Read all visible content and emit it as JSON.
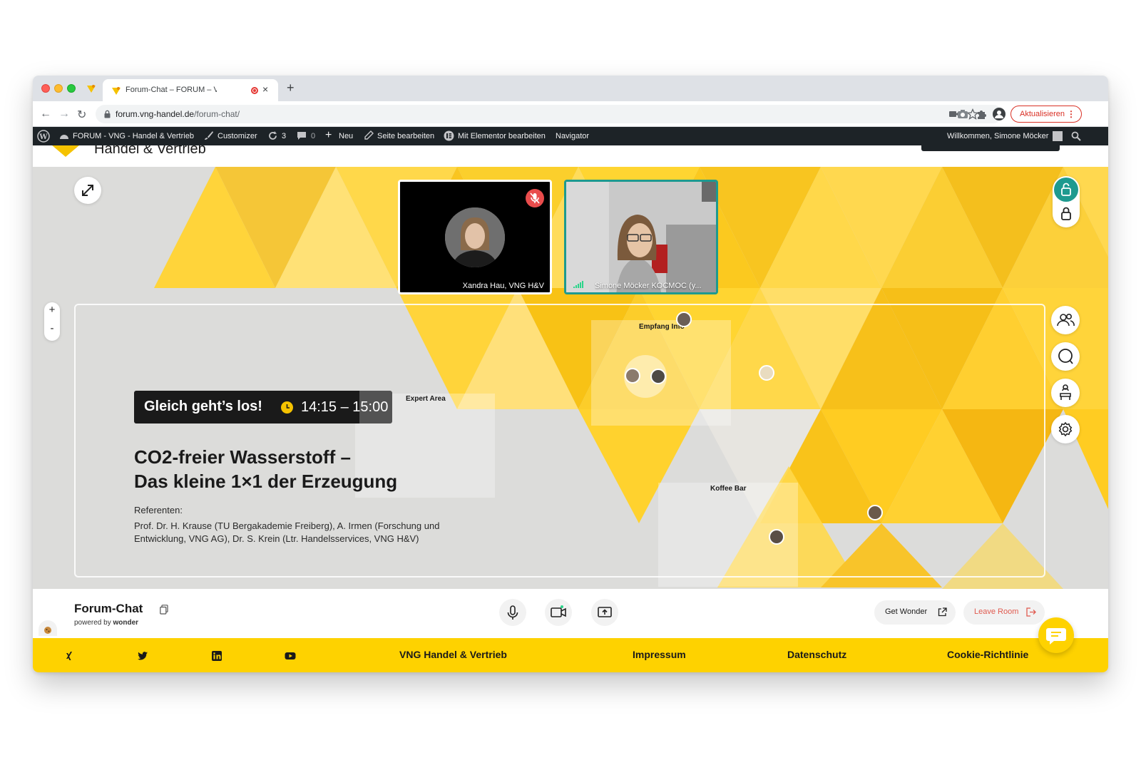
{
  "browser": {
    "tab_title": "Forum-Chat – FORUM – VNG",
    "url_host": "forum.vng-handel.de",
    "url_path": "/forum-chat/",
    "update_label": "Aktualisieren"
  },
  "wp_admin": {
    "site_name": "FORUM - VNG - Handel & Vertrieb",
    "customizer": "Customizer",
    "updates_count": "3",
    "comments_count": "0",
    "new_label": "Neu",
    "edit_page": "Seite bearbeiten",
    "elementor": "Mit Elementor bearbeiten",
    "navigator": "Navigator",
    "greeting": "Willkommen, Simone Möcker"
  },
  "site": {
    "title_partial": "Handel & Vertrieb",
    "accent_color": "#fed200",
    "teal_color": "#1e9a8f"
  },
  "video": {
    "tiles": [
      {
        "name": "Xandra Hau, VNG H&V",
        "muted": true
      },
      {
        "name": "Simone Möcker KOCMOC (y...",
        "muted": false
      }
    ]
  },
  "map": {
    "zones": [
      {
        "label": "Empfang Info"
      },
      {
        "label": "Expert Area"
      },
      {
        "label": "Koffee Bar"
      }
    ]
  },
  "event": {
    "badge_title": "Gleich geht’s los!",
    "time": "14:15 – 15:00",
    "headline_1": "CO2-freier Wasserstoff –",
    "headline_2": "Das kleine 1×1 der Erzeugung",
    "speakers_label": "Referenten:",
    "speakers": "Prof. Dr. H. Krause (TU Bergakademie Freiberg), A. Irmen (Forschung und Entwicklung, VNG AG), Dr. S. Krein (Ltr. Handelsservices, VNG H&V)"
  },
  "room": {
    "name": "Forum-Chat",
    "powered_prefix": "powered by",
    "powered_brand": "wonder",
    "get_wonder": "Get Wonder",
    "leave_room": "Leave Room"
  },
  "zoom": {
    "plus": "+",
    "minus": "-"
  },
  "footer": {
    "icons": [
      "xing-icon",
      "twitter-icon",
      "linkedin-icon",
      "youtube-icon"
    ],
    "links": [
      "VNG Handel & Vertrieb",
      "Impressum",
      "Datenschutz",
      "Cookie-Richtlinie"
    ]
  }
}
